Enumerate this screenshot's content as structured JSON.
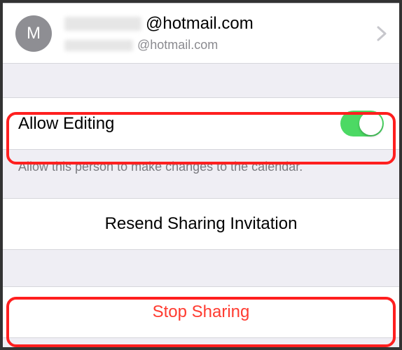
{
  "contact": {
    "avatar_initial": "M",
    "email_suffix_main": "@hotmail.com",
    "email_suffix_sub": "@hotmail.com"
  },
  "allow_editing": {
    "label": "Allow Editing",
    "footer": "Allow this person to make changes to the calendar.",
    "enabled": true
  },
  "actions": {
    "resend": "Resend Sharing Invitation",
    "stop": "Stop Sharing"
  },
  "colors": {
    "toggle_on": "#4cd964",
    "destructive": "#ff3b30",
    "highlight": "#ff1f1f"
  }
}
